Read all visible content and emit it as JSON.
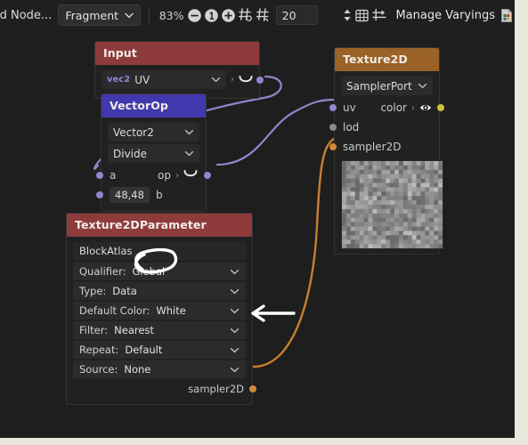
{
  "toolbar": {
    "add_node_label": "ld Node...",
    "stage_select": {
      "value": "Fragment",
      "chevron": "chevron-down-icon"
    },
    "zoom_level": "83%",
    "zoom_out_icon": "minus-circle-icon",
    "zoom_reset_icon": "one-circle-icon",
    "zoom_in_icon": "plus-circle-icon",
    "grid_snap_icon": "grid-snap-icon",
    "grid_size_icon": "grid-size-icon",
    "grid_value": "20",
    "stepper_icon": "stepper-updown-icon",
    "grid_toggle_icon": "grid-toggle-icon",
    "align_icon": "align-distribute-icon",
    "manage_varyings_label": "Manage Varyings",
    "export_icon": "export-document-icon"
  },
  "colors": {
    "input_header": "#8e3b3b",
    "vectorop_header": "#4238ad",
    "texture2d_header": "#9a6226",
    "param_header": "#8e3b3b",
    "wire_purple": "#8b88cf",
    "wire_orange": "#c87e30",
    "pin_yellow": "#cfc13c",
    "annotation": "#ffffff",
    "canvas_bg": "#1e1e1e"
  },
  "nodes": {
    "input": {
      "title": "Input",
      "attribute": {
        "type_badge": "vec2",
        "value": "UV",
        "chevron": "chevron-down-icon"
      },
      "output": {
        "label": "",
        "arrow": "chevron-right-icon",
        "curve_icon": "curve-icon"
      }
    },
    "vectorop": {
      "title": "VectorOp",
      "vector_type": {
        "value": "Vector2",
        "chevron": "chevron-down-icon"
      },
      "operation": {
        "value": "Divide",
        "chevron": "chevron-down-icon"
      },
      "port_a": "a",
      "port_b": "b",
      "b_value": "48,48",
      "output_label": "op",
      "output_arrow": "chevron-right-icon",
      "output_curve": "curve-icon"
    },
    "texture2d": {
      "title": "Texture2D",
      "port_select": {
        "value": "SamplerPort",
        "chevron": "chevron-down-icon"
      },
      "inputs": [
        "uv",
        "lod",
        "sampler2D"
      ],
      "output_label": "color",
      "output_arrow": "chevron-right-icon",
      "preview_icon": "eye-icon"
    },
    "texture2dparameter": {
      "title": "Texture2DParameter",
      "name": "BlockAtlas",
      "fields": [
        {
          "label": "Qualifier:",
          "value": "Global",
          "chevron": "chevron-down-icon"
        },
        {
          "label": "Type:",
          "value": "Data",
          "chevron": "chevron-down-icon"
        },
        {
          "label": "Default Color:",
          "value": "White",
          "chevron": "chevron-down-icon"
        },
        {
          "label": "Filter:",
          "value": "Nearest",
          "chevron": "chevron-down-icon"
        },
        {
          "label": "Repeat:",
          "value": "Default",
          "chevron": "chevron-down-icon"
        },
        {
          "label": "Source:",
          "value": "None",
          "chevron": "chevron-down-icon"
        }
      ],
      "output_label": "sampler2D"
    }
  },
  "annotations": {
    "ellipse_target": "Global",
    "arrow_direction": "left"
  }
}
